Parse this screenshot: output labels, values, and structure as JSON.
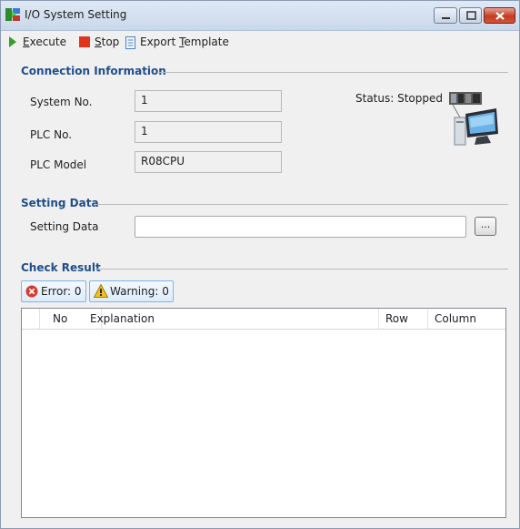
{
  "window": {
    "title": "I/O System Setting",
    "icon": "io-setting-app-icon"
  },
  "toolbar": {
    "execute": {
      "accel": "E",
      "rest": "xecute",
      "icon": "play-icon"
    },
    "stop": {
      "accel": "S",
      "rest": "top",
      "icon": "stop-icon"
    },
    "export": {
      "pre": "Export ",
      "accel": "T",
      "rest": "emplate",
      "icon": "document-icon"
    }
  },
  "connection": {
    "section_title": "Connection Information",
    "system_no_label": "System No.",
    "system_no_value": "1",
    "plc_no_label": "PLC No.",
    "plc_no_value": "1",
    "plc_model_label": "PLC Model",
    "plc_model_value": "R08CPU",
    "status": "Status: Stopped",
    "picture": "plc-computer-icon"
  },
  "setting": {
    "section_title": "Setting Data",
    "label": "Setting Data",
    "value": "",
    "browse_label": "..."
  },
  "check": {
    "section_title": "Check Result",
    "error_label": "Error: 0",
    "warning_label": "Warning: 0",
    "columns": [
      "No",
      "Explanation",
      "Row",
      "Column"
    ],
    "rows": []
  },
  "colors": {
    "section_title": "#1f4e8c",
    "accent_border": "#7eb4ea",
    "close_button": "#c43c22"
  }
}
